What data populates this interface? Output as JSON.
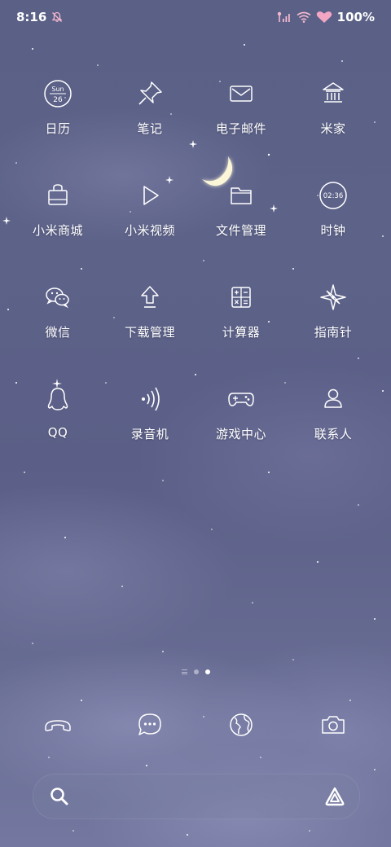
{
  "status": {
    "time": "8:16",
    "battery": "100%"
  },
  "apps": [
    {
      "label": "日历",
      "icon": "calendar-icon",
      "cal_day": "Sun",
      "cal_date": "26"
    },
    {
      "label": "笔记",
      "icon": "pin-icon"
    },
    {
      "label": "电子邮件",
      "icon": "mail-icon"
    },
    {
      "label": "米家",
      "icon": "home-icon"
    },
    {
      "label": "小米商城",
      "icon": "shopping-bag-icon"
    },
    {
      "label": "小米视频",
      "icon": "play-icon"
    },
    {
      "label": "文件管理",
      "icon": "folder-icon"
    },
    {
      "label": "时钟",
      "icon": "clock-icon",
      "clock_time": "02:36"
    },
    {
      "label": "微信",
      "icon": "wechat-icon"
    },
    {
      "label": "下载管理",
      "icon": "download-icon"
    },
    {
      "label": "计算器",
      "icon": "calculator-icon"
    },
    {
      "label": "指南针",
      "icon": "compass-icon"
    },
    {
      "label": "QQ",
      "icon": "penguin-icon"
    },
    {
      "label": "录音机",
      "icon": "recorder-icon"
    },
    {
      "label": "游戏中心",
      "icon": "gamepad-icon"
    },
    {
      "label": "联系人",
      "icon": "contact-icon"
    }
  ],
  "dock": [
    {
      "icon": "phone-icon"
    },
    {
      "icon": "message-icon"
    },
    {
      "icon": "browser-icon"
    },
    {
      "icon": "camera-icon"
    }
  ],
  "page_indicator": {
    "pages": 2,
    "active": 2
  },
  "colors": {
    "background": "#5d6289",
    "foreground": "#ffffff"
  }
}
